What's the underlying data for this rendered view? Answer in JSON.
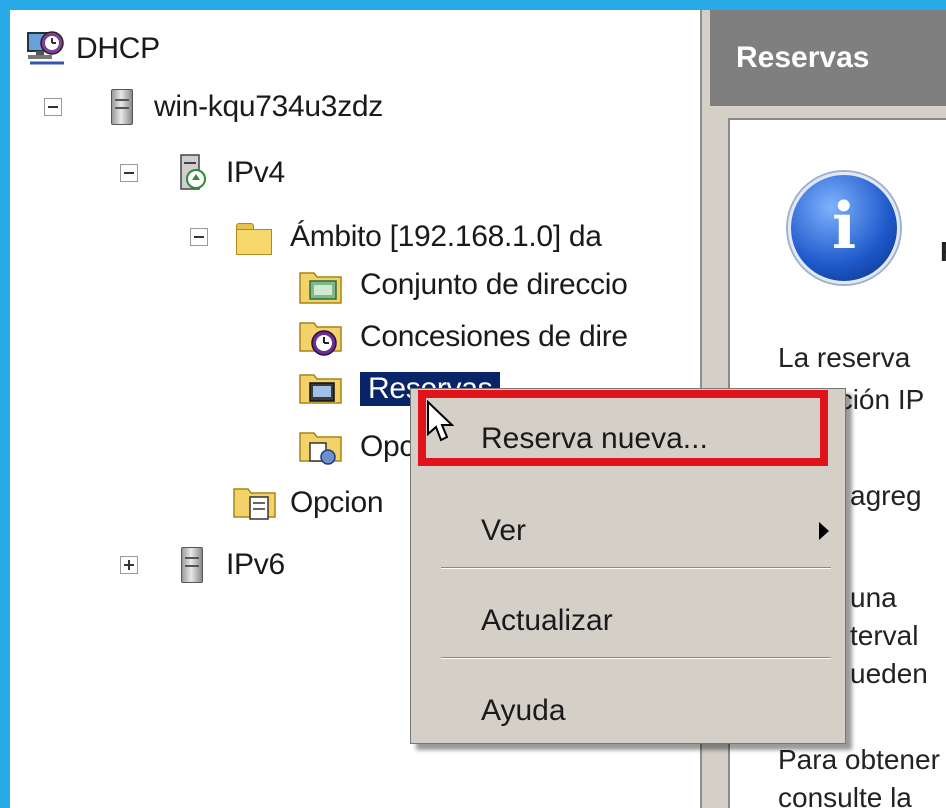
{
  "tree": {
    "root": "DHCP",
    "server": "win-kqu734u3zdz",
    "ipv4": "IPv4",
    "scope": "Ámbito [192.168.1.0] da",
    "pool": "Conjunto de direccio",
    "leases": "Concesiones de dire",
    "reservations": "Reservas",
    "scope_options": "Opc",
    "server_options": "Opcion",
    "ipv6": "IPv6"
  },
  "right_pane": {
    "header": "Reservas",
    "heading_fragment": "R",
    "lines": [
      "La reserva",
      "dirección IP",
      "agreg",
      "una",
      "terval",
      "ueden",
      "Para obtener",
      "consulte la"
    ]
  },
  "context_menu": {
    "items": [
      {
        "label": "Reserva nueva..."
      },
      {
        "label": "Ver",
        "submenu": true
      },
      {
        "label": "Actualizar"
      },
      {
        "label": "Ayuda"
      }
    ],
    "highlight_color": "#e0131a"
  },
  "colors": {
    "background": "#29a9e6",
    "selection": "#0a246a",
    "menu_bg": "#d4d0c8"
  }
}
